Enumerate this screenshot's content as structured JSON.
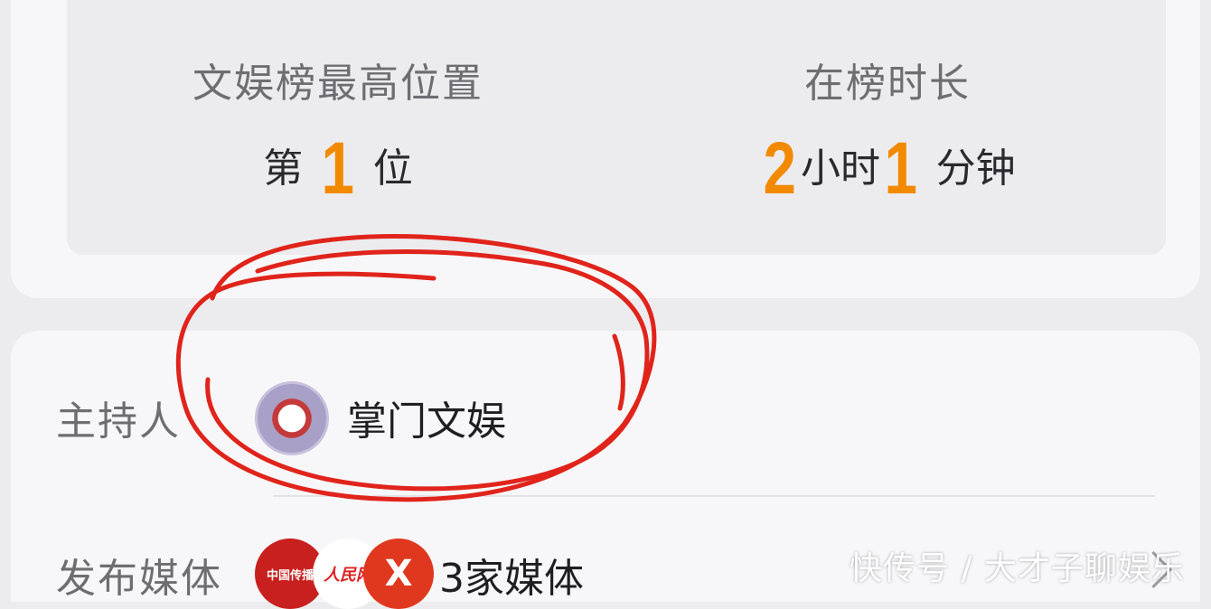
{
  "stats": {
    "rank": {
      "label": "文娱榜最高位置",
      "prefix": "第",
      "value": "1",
      "suffix": "位"
    },
    "duration": {
      "label": "在榜时长",
      "hours": "2",
      "hours_unit": "小时",
      "minutes": "1",
      "minutes_unit": "分钟"
    }
  },
  "host": {
    "label": "主持人",
    "name": "掌门文娱"
  },
  "media": {
    "label": "发布媒体",
    "count_text": "3家媒体",
    "logo1_text": "中国传播",
    "logo2_text": "人民网",
    "logo3_text": "X"
  },
  "watermark": "快传号 / 大才子聊娱乐",
  "colors": {
    "accent": "#f28a00",
    "annotation": "#e0241b",
    "background": "#ececef"
  },
  "icons": {
    "chevron": "chevron-right-icon"
  }
}
